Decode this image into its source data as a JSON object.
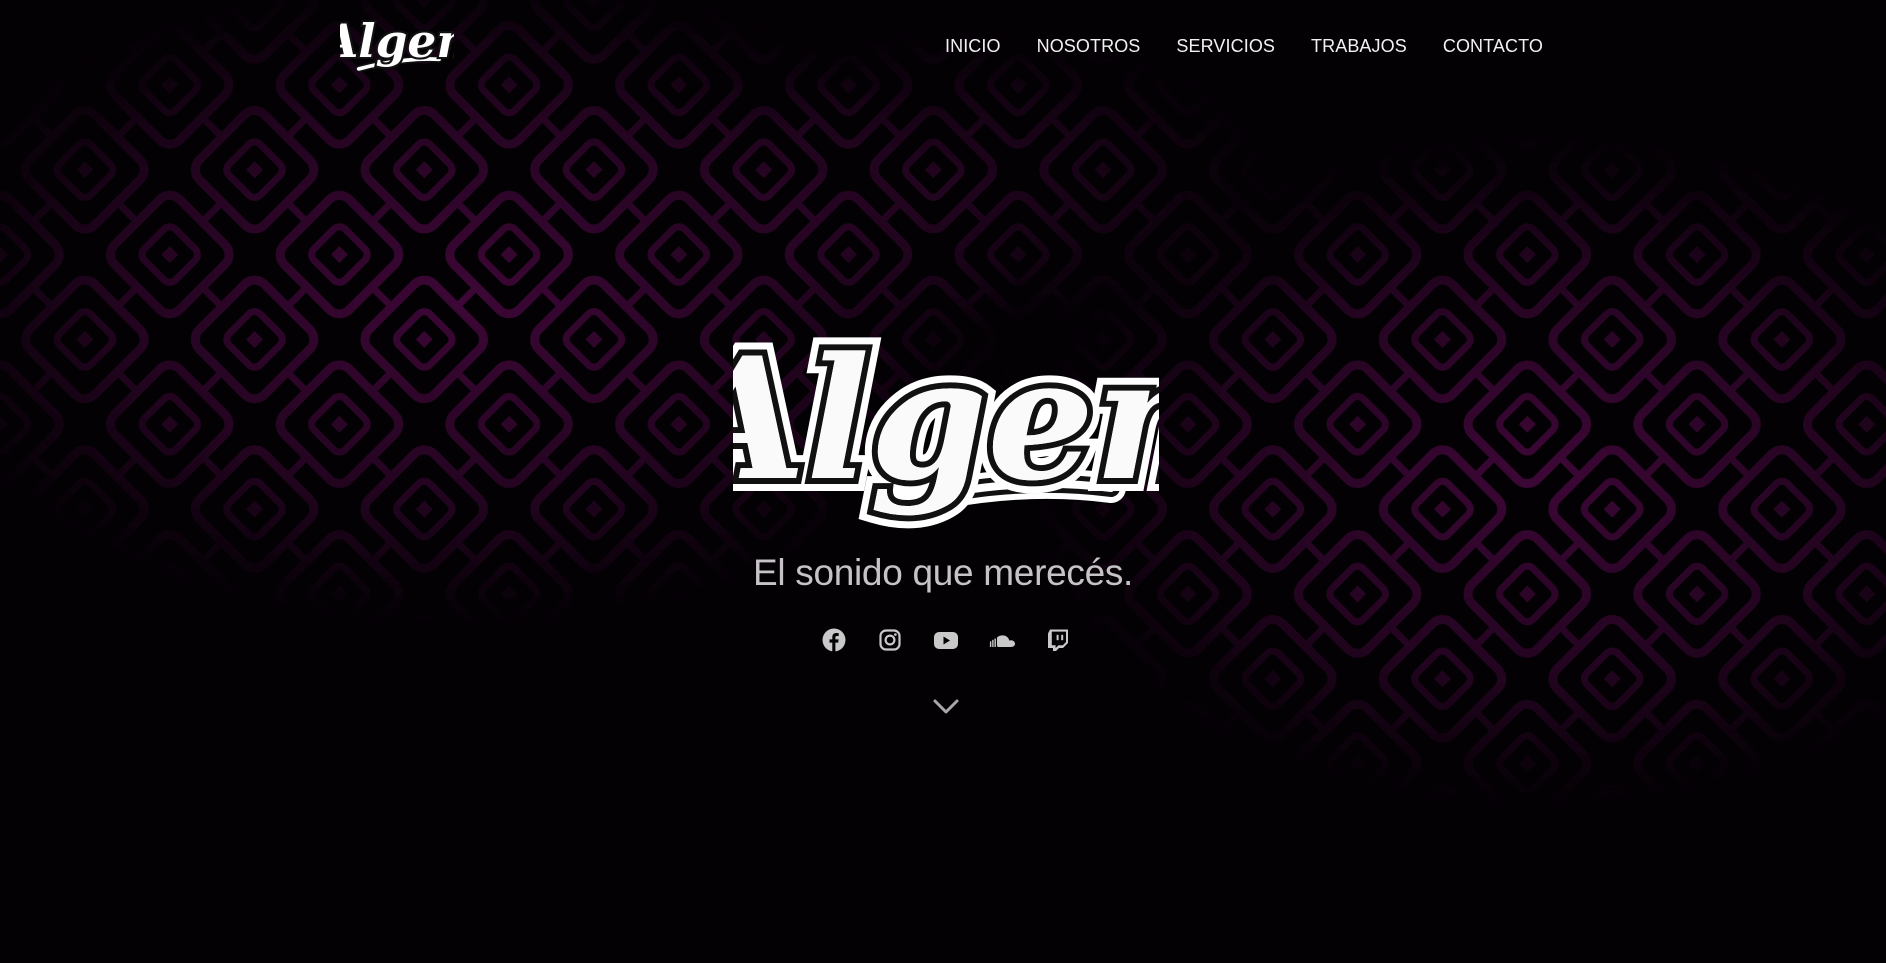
{
  "brand": {
    "logo_text": "Algen"
  },
  "nav": {
    "items": [
      {
        "label": "INICIO"
      },
      {
        "label": "NOSOTROS"
      },
      {
        "label": "SERVICIOS"
      },
      {
        "label": "TRABAJOS"
      },
      {
        "label": "CONTACTO"
      }
    ]
  },
  "hero": {
    "logo_text": "Algen",
    "tagline": "El sonido que merecés.",
    "socials": [
      {
        "icon": "facebook-icon"
      },
      {
        "icon": "instagram-icon"
      },
      {
        "icon": "youtube-icon"
      },
      {
        "icon": "soundcloud-icon"
      },
      {
        "icon": "twitch-icon"
      }
    ],
    "scroll_icon": "chevron-down-icon"
  },
  "colors": {
    "background": "#030104",
    "accent_purple": "#5a0a4e",
    "nav_text": "#f2f2f2",
    "tagline": "#c6c3c7",
    "icons": "#c9c9c9"
  }
}
